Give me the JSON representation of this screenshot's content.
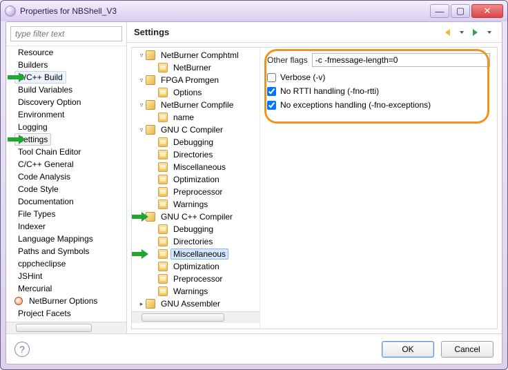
{
  "window": {
    "title": "Properties for NBShell_V3"
  },
  "filter": {
    "placeholder": "type filter text"
  },
  "leftTree": {
    "items": [
      {
        "label": "Resource",
        "indent": 1
      },
      {
        "label": "Builders",
        "indent": 1
      },
      {
        "label": "C/C++ Build",
        "indent": 1,
        "hover": true,
        "arrow": true
      },
      {
        "label": "Build Variables",
        "indent": 2
      },
      {
        "label": "Discovery Option",
        "indent": 2
      },
      {
        "label": "Environment",
        "indent": 2
      },
      {
        "label": "Logging",
        "indent": 2
      },
      {
        "label": "Settings",
        "indent": 2,
        "selected": true,
        "arrow": true
      },
      {
        "label": "Tool Chain Editor",
        "indent": 2
      },
      {
        "label": "C/C++ General",
        "indent": 1
      },
      {
        "label": "Code Analysis",
        "indent": 2
      },
      {
        "label": "Code Style",
        "indent": 2
      },
      {
        "label": "Documentation",
        "indent": 2
      },
      {
        "label": "File Types",
        "indent": 2
      },
      {
        "label": "Indexer",
        "indent": 2
      },
      {
        "label": "Language Mappings",
        "indent": 2
      },
      {
        "label": "Paths and Symbols",
        "indent": 2
      },
      {
        "label": "cppcheclipse",
        "indent": 1
      },
      {
        "label": "JSHint",
        "indent": 1
      },
      {
        "label": "Mercurial",
        "indent": 1
      },
      {
        "label": "NetBurner Options",
        "indent": 1,
        "icon": "nb"
      },
      {
        "label": "Project Facets",
        "indent": 1
      }
    ]
  },
  "header": {
    "title": "Settings"
  },
  "midTree": {
    "items": [
      {
        "label": "NetBurner Comphtml",
        "indent": 0,
        "expander": "▿",
        "icon": "tool"
      },
      {
        "label": "NetBurner",
        "indent": 1,
        "icon": "fold"
      },
      {
        "label": "FPGA Promgen",
        "indent": 0,
        "expander": "▿",
        "icon": "tool"
      },
      {
        "label": "Options",
        "indent": 1,
        "icon": "fold"
      },
      {
        "label": "NetBurner Compfile",
        "indent": 0,
        "expander": "▿",
        "icon": "tool"
      },
      {
        "label": "name",
        "indent": 1,
        "icon": "fold"
      },
      {
        "label": "GNU C Compiler",
        "indent": 0,
        "expander": "▿",
        "icon": "tool"
      },
      {
        "label": "Debugging",
        "indent": 1,
        "icon": "fold"
      },
      {
        "label": "Directories",
        "indent": 1,
        "icon": "fold"
      },
      {
        "label": "Miscellaneous",
        "indent": 1,
        "icon": "fold"
      },
      {
        "label": "Optimization",
        "indent": 1,
        "icon": "fold"
      },
      {
        "label": "Preprocessor",
        "indent": 1,
        "icon": "fold"
      },
      {
        "label": "Warnings",
        "indent": 1,
        "icon": "fold"
      },
      {
        "label": "GNU C++ Compiler",
        "indent": 0,
        "expander": "▿",
        "icon": "tool",
        "arrow": true
      },
      {
        "label": "Debugging",
        "indent": 1,
        "icon": "fold"
      },
      {
        "label": "Directories",
        "indent": 1,
        "icon": "fold"
      },
      {
        "label": "Miscellaneous",
        "indent": 1,
        "icon": "fold",
        "selected": true,
        "arrow": true
      },
      {
        "label": "Optimization",
        "indent": 1,
        "icon": "fold"
      },
      {
        "label": "Preprocessor",
        "indent": 1,
        "icon": "fold"
      },
      {
        "label": "Warnings",
        "indent": 1,
        "icon": "fold"
      },
      {
        "label": "GNU Assembler",
        "indent": 0,
        "expander": "▸",
        "icon": "tool"
      }
    ]
  },
  "form": {
    "otherFlagsLabel": "Other flags",
    "otherFlagsValue": "-c -fmessage-length=0",
    "verbose": {
      "label": "Verbose (-v)",
      "checked": false
    },
    "nortti": {
      "label": "No RTTI handling (-fno-rtti)",
      "checked": true
    },
    "noexc": {
      "label": "No exceptions handling (-fno-exceptions)",
      "checked": true
    }
  },
  "buttons": {
    "ok": "OK",
    "cancel": "Cancel"
  }
}
